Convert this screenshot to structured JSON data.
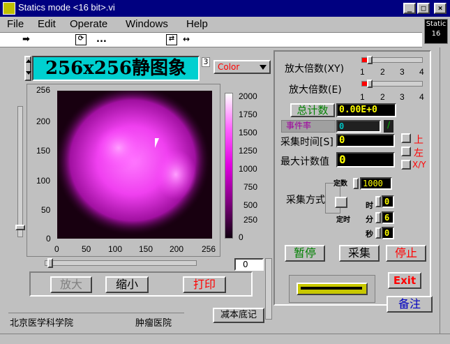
{
  "window": {
    "title": "Statics  mode <16 bit>.vi",
    "buttons": [
      "_",
      "□",
      "×"
    ]
  },
  "menu": [
    {
      "label": "File"
    },
    {
      "label": "Edit"
    },
    {
      "label": "Operate"
    },
    {
      "label": "Windows"
    },
    {
      "label": "Help"
    }
  ],
  "toolbar": {
    "ellipsis": "..."
  },
  "static_badge": {
    "line1": "Static",
    "line2": "16"
  },
  "header": {
    "title": "256x256静图象",
    "index": "3",
    "color_select": "Color"
  },
  "graph": {
    "y_ticks": [
      "256",
      "200",
      "150",
      "100",
      "50",
      "0"
    ],
    "x_ticks": [
      "0",
      "50",
      "100",
      "150",
      "200",
      "256"
    ],
    "colorbar_ticks": [
      "2000",
      "1750",
      "1500",
      "1250",
      "1000",
      "750",
      "500",
      "250",
      "0"
    ],
    "h_slider_value": "0"
  },
  "buttons": {
    "zoom_in": "放大",
    "zoom_out": "缩小",
    "print": "打印",
    "pause": "暂停",
    "acquire": "采集",
    "stop": "停止",
    "exit": "Exit",
    "note": "备注",
    "subtract_bg": "减本底记"
  },
  "footer": {
    "org": "北京医学科学院",
    "dept": "肿瘤医院"
  },
  "right_panel": {
    "zoom_xy_label": "放大倍数(XY)",
    "zoom_e_label": "放大倍数(E)",
    "slider_ticks": [
      "1",
      "2",
      "3",
      "4"
    ],
    "zoom_xy_level": 1.3,
    "zoom_e_level": 1.3,
    "total_count_label": "总计数",
    "total_count_value": "0.00E+0",
    "event_rate_label": "事件率",
    "event_rate_value": "0",
    "acq_time_label": "采集时间[S]",
    "acq_time_value": "0",
    "max_count_label": "最大计数值",
    "max_count_value": "0",
    "up_label": "上",
    "left_label": "左",
    "xy_label": "X/Y",
    "mode_label": "采集方式",
    "fixed_count_label": "定数",
    "fixed_count_value": "1000",
    "fixed_time_label": "定时",
    "hour_label": "时",
    "minute_label": "分",
    "second_label": "秒",
    "hour_value": "0",
    "minute_value": "6",
    "second_value": "0"
  },
  "colors": {
    "accent_red": "#ff0000",
    "lcd_cyan": "#00d0d0",
    "digit_yellow": "#ffff00",
    "title_blue": "#000080"
  }
}
